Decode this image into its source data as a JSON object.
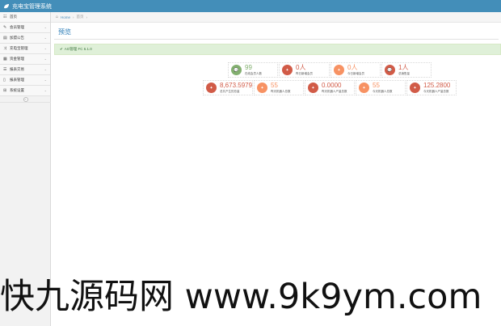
{
  "app": {
    "title": "充电宝管理系统"
  },
  "sidebar": {
    "items": [
      {
        "label": "首页",
        "icon": "dashboard-icon",
        "has_children": false
      },
      {
        "label": "会员管理",
        "icon": "edit-icon",
        "has_children": true
      },
      {
        "label": "加盟公告",
        "icon": "book-icon",
        "has_children": true
      },
      {
        "label": "充电宝管理",
        "icon": "shuffle-icon",
        "has_children": true
      },
      {
        "label": "资金管理",
        "icon": "calendar-icon",
        "has_children": true
      },
      {
        "label": "报表交易",
        "icon": "list-icon",
        "has_children": true
      },
      {
        "label": "报表管理",
        "icon": "file-icon",
        "has_children": true
      },
      {
        "label": "系统设置",
        "icon": "sitemap-icon",
        "has_children": true
      }
    ]
  },
  "breadcrumb": {
    "home": "Home",
    "separator": "›",
    "current": "首页"
  },
  "page": {
    "title": "预览"
  },
  "alert": {
    "text": "AG管理 FC 6.1.0"
  },
  "stats_row1": [
    {
      "value": "99",
      "label": "在线会员人数",
      "color": "#82af6f",
      "value_color": "#82af6f",
      "icon": "comment-icon"
    },
    {
      "value": "0人",
      "label": "昨日新增会员",
      "color": "#d15b47",
      "value_color": "#d15b47",
      "icon": "twitter-icon"
    },
    {
      "value": "0人",
      "label": "今日新增会员",
      "color": "#f79263",
      "value_color": "#f79263",
      "icon": "twitter-icon"
    },
    {
      "value": "1人",
      "label": "总销售量",
      "color": "#d15b47",
      "value_color": "#d15b47",
      "icon": "comment-icon"
    }
  ],
  "stats_row2": [
    {
      "value": "8,673.5979",
      "label": "总共产生的总量",
      "color": "#d15b47",
      "value_color": "#d15b47",
      "icon": "twitter-icon"
    },
    {
      "value": "55",
      "label": "昨天机器人总数",
      "color": "#f79263",
      "value_color": "#f79263",
      "icon": "twitter-icon"
    },
    {
      "value": "0.0000",
      "label": "昨天机器人产量总数",
      "color": "#d15b47",
      "value_color": "#d15b47",
      "icon": "twitter-icon"
    },
    {
      "value": "55",
      "label": "今天机器人总数",
      "color": "#f79263",
      "value_color": "#f79263",
      "icon": "twitter-icon"
    },
    {
      "value": "125.2800",
      "label": "今天机器人产量总数",
      "color": "#d15b47",
      "value_color": "#d15b47",
      "icon": "twitter-icon"
    }
  ],
  "watermark": {
    "text": "快九源码网 www.9k9ym.com"
  }
}
